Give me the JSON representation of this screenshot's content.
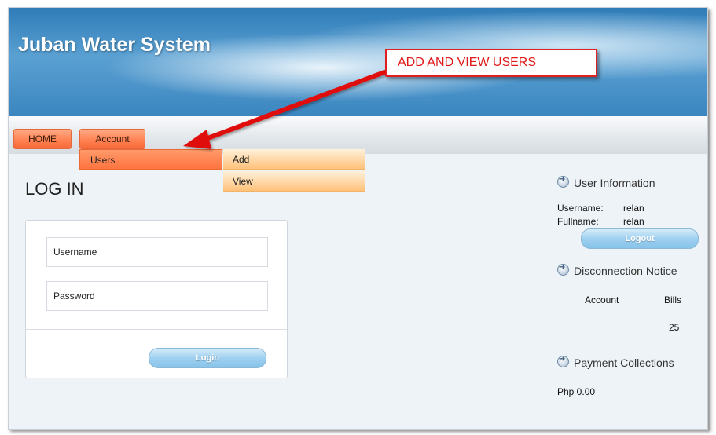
{
  "header": {
    "title": "Juban Water System"
  },
  "nav": {
    "home": "HOME",
    "account": "Account"
  },
  "dropdown": {
    "users": "Users",
    "submenu": [
      "Add",
      "View"
    ]
  },
  "callout": {
    "text": "ADD AND VIEW USERS"
  },
  "login": {
    "heading": "LOG IN",
    "username_placeholder": "Username",
    "password_placeholder": "Password",
    "button": "Login"
  },
  "sidebar": {
    "user_info": {
      "title": "User Information",
      "username_label": "Username:",
      "username_value": "relan",
      "fullname_label": "Fullname:",
      "fullname_value": "relan",
      "logout": "Logout"
    },
    "disconnection": {
      "title": "Disconnection Notice",
      "col_account": "Account",
      "col_bills": "Bills",
      "bills_value": "25"
    },
    "payments": {
      "title": "Payment Collections",
      "amount": "Php 0.00"
    }
  },
  "colors": {
    "accent": "#ff7f50",
    "callout": "#e01818",
    "header": "#3b86c0"
  }
}
